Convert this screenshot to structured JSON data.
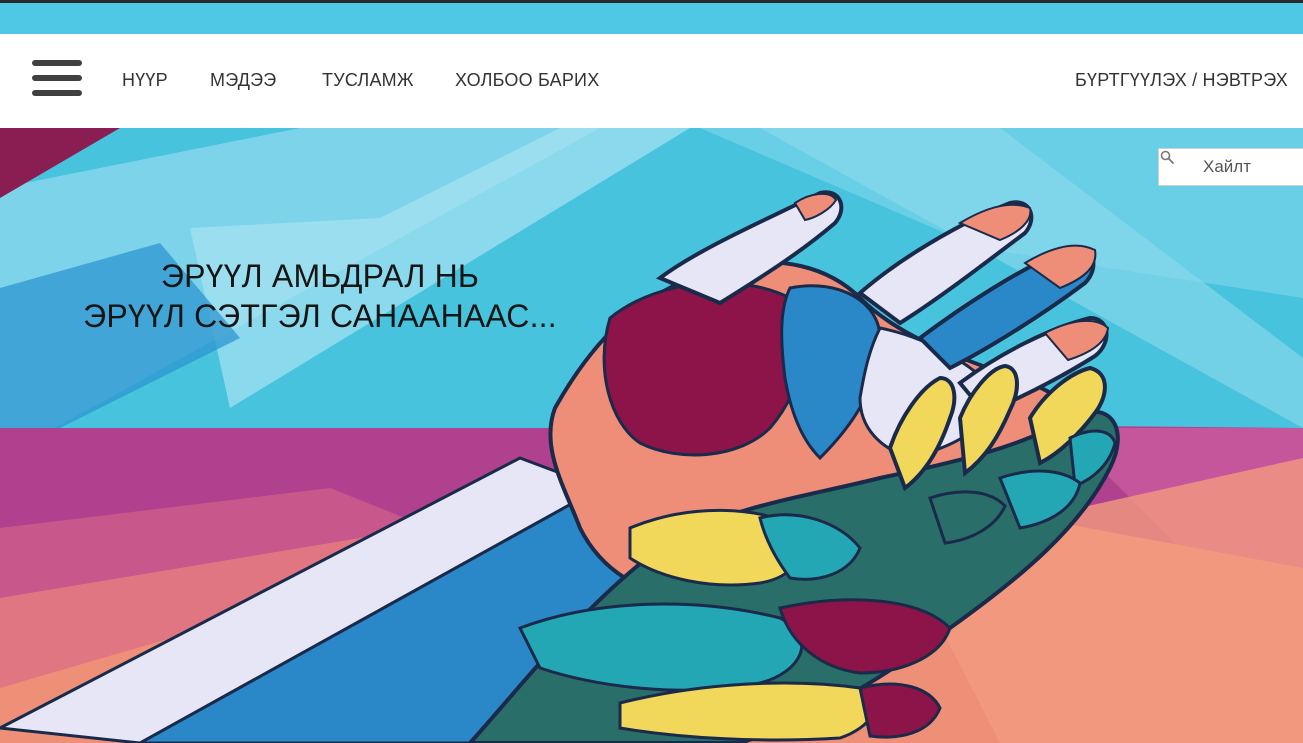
{
  "nav": {
    "menu_icon": "hamburger-menu-icon",
    "links": [
      "НҮҮР",
      "МЭДЭЭ",
      "ТУСЛАМЖ",
      "ХОЛБОО БАРИХ"
    ],
    "auth_link": "БҮРТГҮҮЛЭХ / НЭВТРЭХ"
  },
  "hero": {
    "headline_line1": "ЭРҮҮЛ АМЬДРАЛ НЬ",
    "headline_line2": "ЭРҮҮЛ СЭТГЭЛ САНААНААС..."
  },
  "search": {
    "placeholder": "Хайлт",
    "icon": "search-icon"
  },
  "colors": {
    "top_strip": "#4ec8e4",
    "navbar_bg": "#ffffff",
    "nav_text": "#333333",
    "sky": "#48c3dd",
    "magenta": "#b0418e",
    "coral": "#ee8f78",
    "maroon": "#8c1448",
    "yellow": "#f2d85a",
    "teal": "#2a6e6a",
    "lavender": "#e6e6f6",
    "blue": "#2a88c8"
  }
}
